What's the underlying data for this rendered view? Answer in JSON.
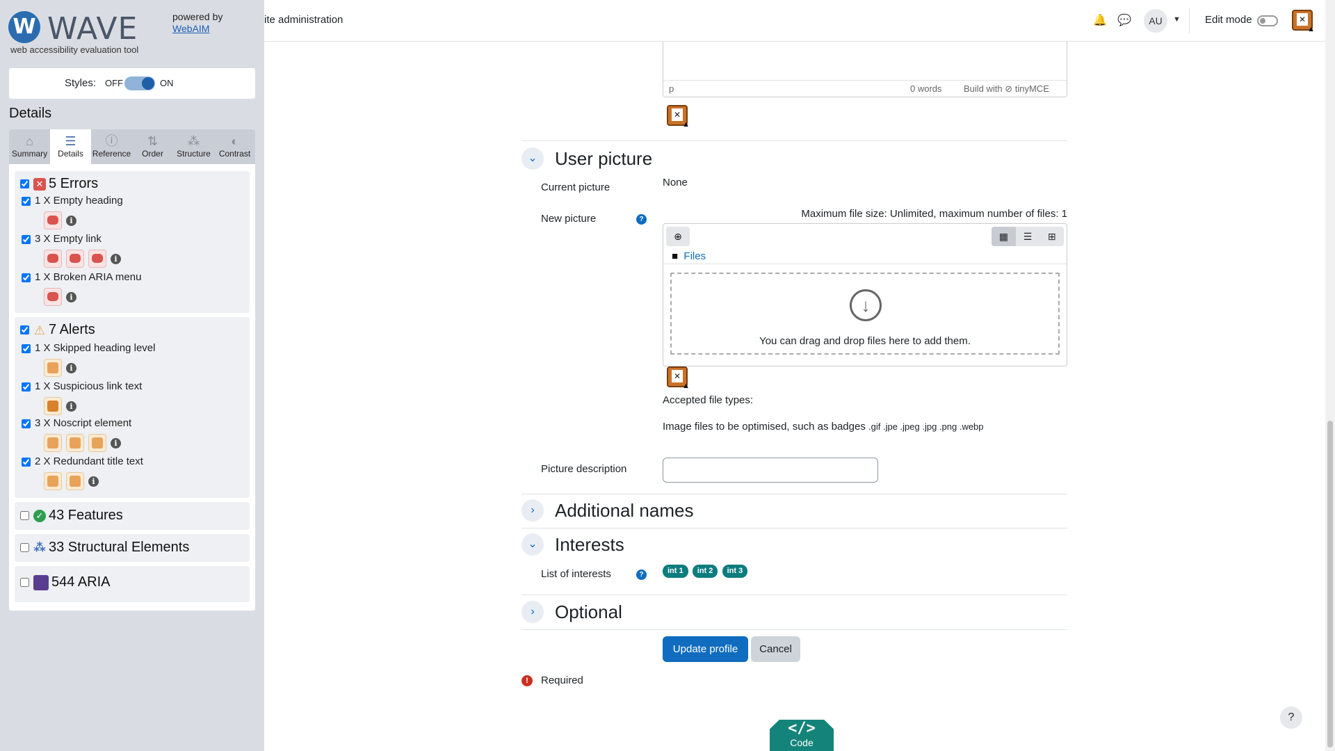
{
  "wave": {
    "brand": "WAVE",
    "tagline": "web accessibility evaluation tool",
    "powered_by": "powered by",
    "webaim": "WebAIM",
    "styles_label": "Styles:",
    "styles_off": "OFF",
    "styles_on": "ON",
    "details_heading": "Details",
    "tabs": [
      {
        "label": "Summary",
        "icon": "home-icon"
      },
      {
        "label": "Details",
        "icon": "list-icon"
      },
      {
        "label": "Reference",
        "icon": "info-icon"
      },
      {
        "label": "Order",
        "icon": "order-icon"
      },
      {
        "label": "Structure",
        "icon": "structure-icon"
      },
      {
        "label": "Contrast",
        "icon": "contrast-icon"
      }
    ],
    "errors": {
      "title": "5 Errors",
      "items": [
        "1 X Empty heading",
        "3 X Empty link",
        "1 X Broken ARIA menu"
      ]
    },
    "alerts": {
      "title": "7 Alerts",
      "items": [
        "1 X Skipped heading level",
        "1 X Suspicious link text",
        "3 X Noscript element",
        "2 X Redundant title text"
      ]
    },
    "features": "43 Features",
    "structural": "33 Structural Elements",
    "aria": "544 ARIA",
    "colors": {
      "error": "#d9534f",
      "alert": "#e8a35b",
      "feature": "#2e9e4f",
      "structure": "#3b6fb6",
      "aria": "#5b3d8f"
    }
  },
  "topbar": {
    "breadcrumb": "ite administration",
    "avatar_initials": "AU",
    "edit_mode": "Edit mode"
  },
  "editor": {
    "path": "p",
    "words": "0 words",
    "build": "Build with ⊘ tinyMCE"
  },
  "user_picture": {
    "section_title": "User picture",
    "current_label": "Current picture",
    "current_value": "None",
    "new_label": "New picture",
    "max_size": "Maximum file size: Unlimited, maximum number of files: 1",
    "files_label": "Files",
    "drop_text": "You can drag and drop files here to add them.",
    "accepted_label": "Accepted file types:",
    "accepted_desc": "Image files to be optimised, such as badges",
    "accepted_exts": ".gif .jpe .jpeg .jpg .png .webp",
    "description_label": "Picture description"
  },
  "additional_names": {
    "section_title": "Additional names"
  },
  "interests": {
    "section_title": "Interests",
    "list_label": "List of interests",
    "tags": [
      "int 1",
      "int 2",
      "int 3"
    ]
  },
  "optional": {
    "section_title": "Optional"
  },
  "actions": {
    "update": "Update profile",
    "cancel": "Cancel"
  },
  "required_label": "Required",
  "code_tab": {
    "symbol": "</>",
    "label": "Code"
  },
  "help_fab": "?"
}
